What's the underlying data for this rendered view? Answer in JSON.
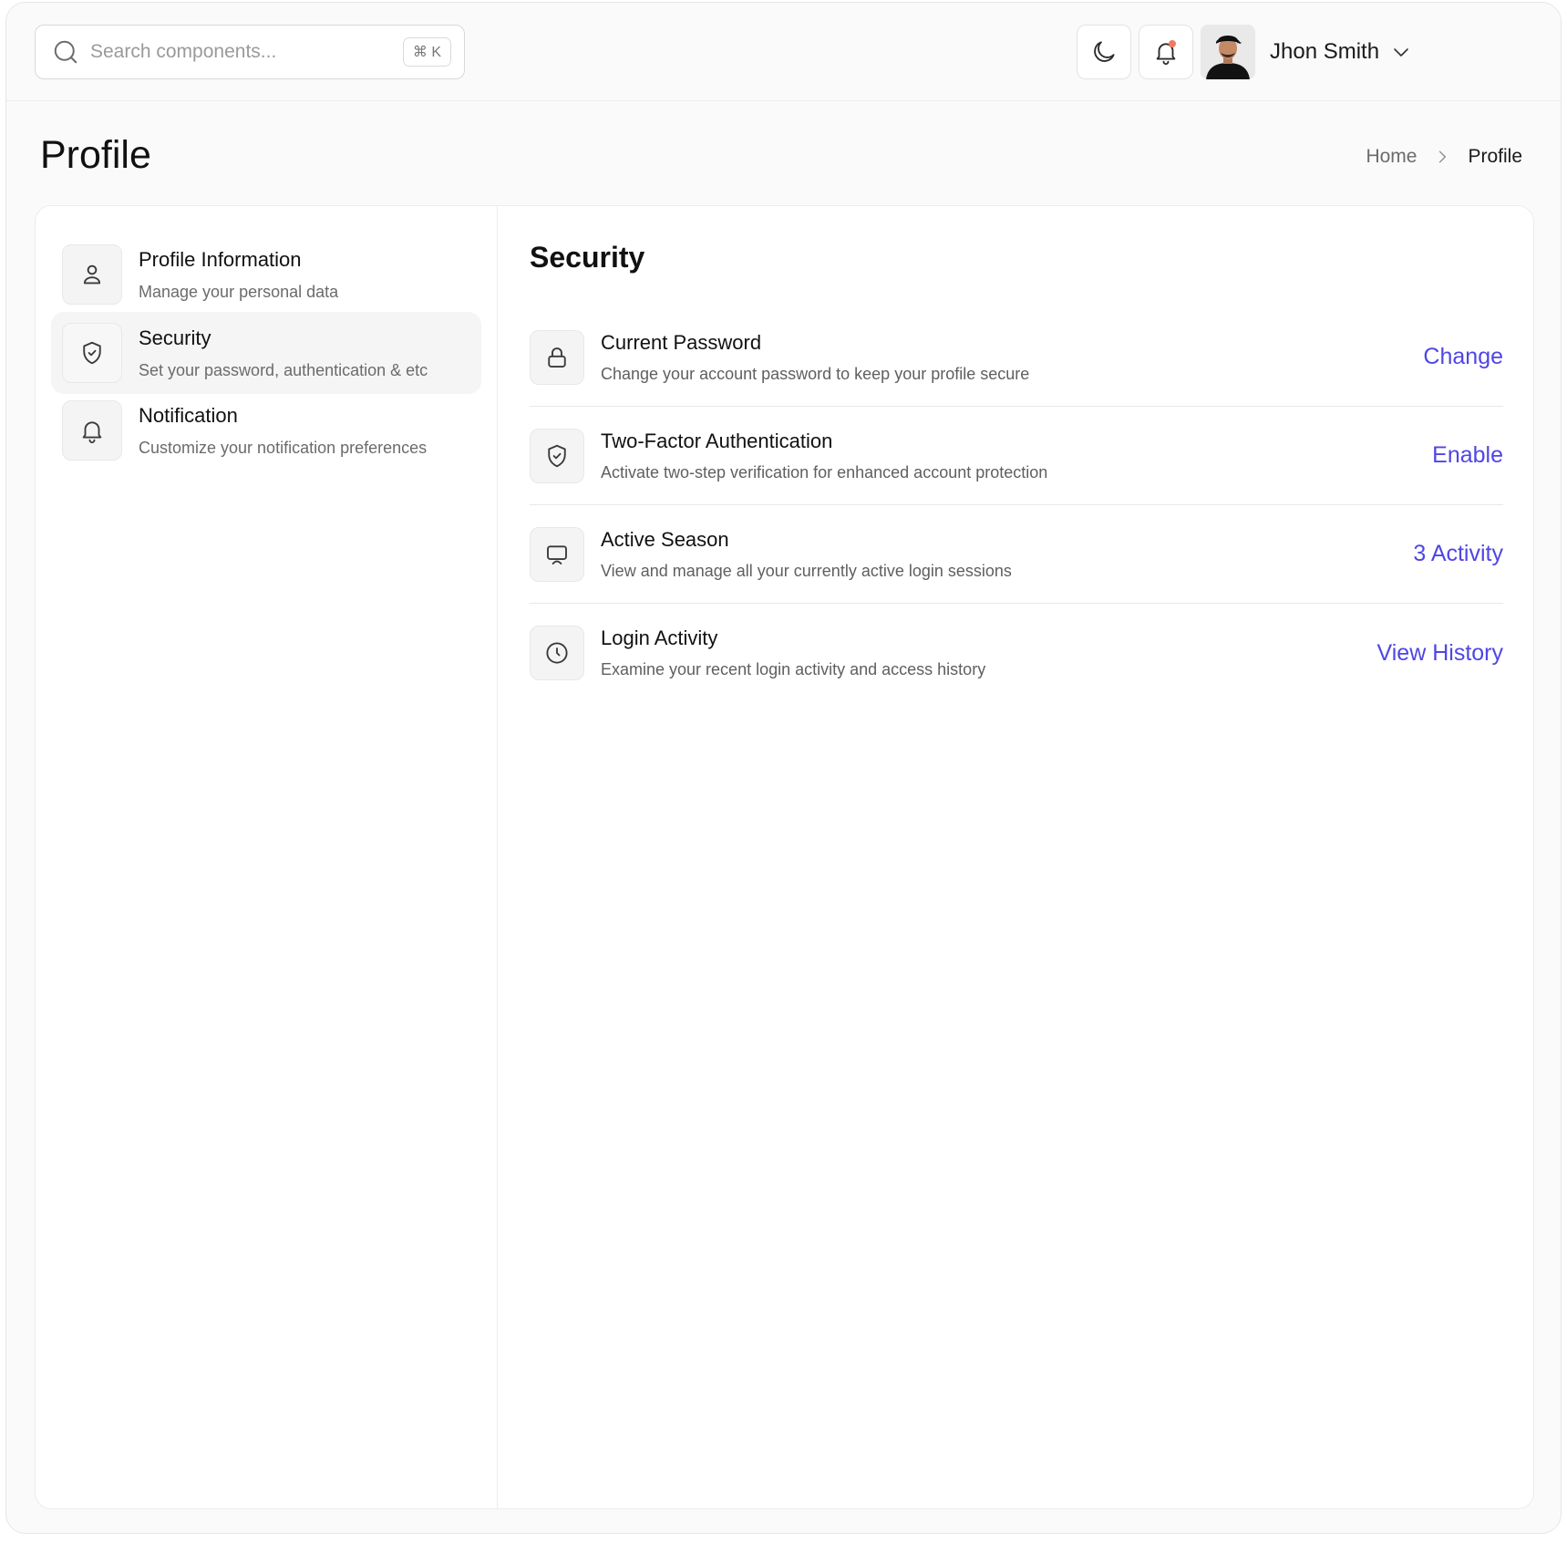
{
  "search": {
    "placeholder": "Search components...",
    "shortcut": "⌘ K"
  },
  "user": {
    "name": "Jhon Smith"
  },
  "page": {
    "title": "Profile"
  },
  "breadcrumb": {
    "home": "Home",
    "current": "Profile"
  },
  "sidebar": {
    "items": [
      {
        "title": "Profile Information",
        "desc": "Manage your personal data",
        "icon": "user-icon",
        "active": false
      },
      {
        "title": "Security",
        "desc": "Set your password, authentication & etc",
        "icon": "shield-check-icon",
        "active": true
      },
      {
        "title": "Notification",
        "desc": "Customize your notification preferences",
        "icon": "bell-icon",
        "active": false
      }
    ]
  },
  "security": {
    "title": "Security",
    "rows": [
      {
        "title": "Current Password",
        "desc": "Change your account password to keep your profile secure",
        "action": "Change",
        "icon": "lock-icon"
      },
      {
        "title": "Two-Factor Authentication",
        "desc": "Activate two-step verification for enhanced account protection",
        "action": "Enable",
        "icon": "shield-check-icon"
      },
      {
        "title": "Active Season",
        "desc": "View and manage all your currently active login sessions",
        "action": "3 Activity",
        "icon": "monitor-icon"
      },
      {
        "title": "Login Activity",
        "desc": "Examine your recent login activity and access history",
        "action": "View History",
        "icon": "clock-icon"
      }
    ]
  },
  "colors": {
    "accent": "#4f46e5",
    "notification_dot": "#f07a63"
  }
}
